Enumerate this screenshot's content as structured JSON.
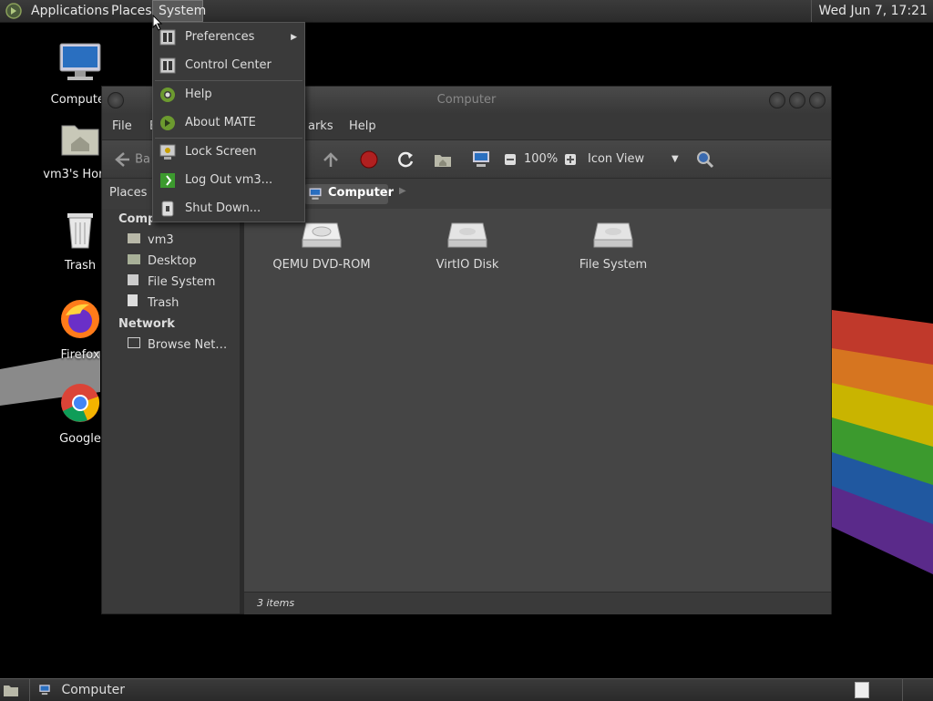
{
  "top_panel": {
    "applications": "Applications",
    "places": "Places",
    "system": "System",
    "clock": "Wed Jun  7, 17:21"
  },
  "desktop_icons": [
    {
      "label": "Computer",
      "icon": "computer-icon"
    },
    {
      "label": "vm3's Home",
      "icon": "home-folder-icon"
    },
    {
      "label": "Trash",
      "icon": "trash-icon"
    },
    {
      "label": "Firefox",
      "icon": "firefox-icon"
    },
    {
      "label": "Google",
      "icon": "chrome-icon"
    }
  ],
  "window": {
    "title": "Computer",
    "menubar": [
      "File",
      "E",
      "arks",
      "Help"
    ],
    "toolbar": {
      "back_label": "Ba",
      "zoom": "100%",
      "view_mode": "Icon View"
    },
    "location": {
      "places_label": "Places",
      "crumb": "Computer"
    },
    "sidebar": {
      "computer_header": "Computer",
      "computer_items": [
        "vm3",
        "Desktop",
        "File System",
        "Trash"
      ],
      "network_header": "Network",
      "network_items": [
        "Browse Net…"
      ]
    },
    "files": [
      {
        "name": "QEMU DVD-ROM",
        "icon": "optical-drive-icon"
      },
      {
        "name": "VirtIO Disk",
        "icon": "hard-disk-icon"
      },
      {
        "name": "File System",
        "icon": "hard-disk-icon"
      }
    ],
    "status": "3 items"
  },
  "system_menu": {
    "items": [
      {
        "label": "Preferences",
        "icon": "preferences-icon",
        "submenu": true
      },
      {
        "label": "Control Center",
        "icon": "control-center-icon"
      },
      {
        "label": "Help",
        "icon": "help-icon"
      },
      {
        "label": "About MATE",
        "icon": "mate-icon"
      },
      {
        "label": "Lock Screen",
        "icon": "lock-screen-icon"
      },
      {
        "label": "Log Out vm3...",
        "icon": "logout-icon"
      },
      {
        "label": "Shut Down...",
        "icon": "shutdown-icon"
      }
    ]
  },
  "bottom_panel": {
    "task": "Computer"
  },
  "colors": {
    "panel_bg": "#2e2e2e",
    "menu_bg": "#3a3a3a",
    "content_bg": "#454545",
    "mate_green": "#6c9a2f"
  }
}
